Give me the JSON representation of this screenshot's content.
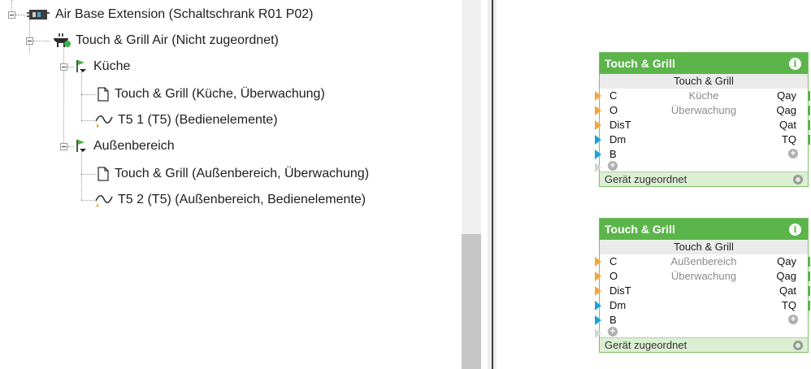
{
  "tree": {
    "nodes": [
      {
        "label": "Air Base Extension (Schaltschrank R01 P02)",
        "icon": "air-base-device-icon"
      },
      {
        "label": "Touch & Grill Air (Nicht zugeordnet)",
        "icon": "grill-device-icon"
      },
      {
        "label": "Küche",
        "icon": "room-flag-icon"
      },
      {
        "label": "Touch & Grill (Küche, Überwachung)",
        "icon": "document-icon"
      },
      {
        "label": "T5 1 (T5) (Bedienelemente)",
        "icon": "signal-wave-icon"
      },
      {
        "label": "Außenbereich",
        "icon": "room-flag-icon"
      },
      {
        "label": "Touch & Grill (Außenbereich, Überwachung)",
        "icon": "document-icon"
      },
      {
        "label": "T5 2 (T5) (Außenbereich, Bedienelemente)",
        "icon": "signal-wave-icon"
      }
    ]
  },
  "blocks": [
    {
      "title": "Touch & Grill",
      "subtitle": "Touch & Grill",
      "param1": "Küche",
      "param2": "Überwachung",
      "inputs": [
        "C",
        "O",
        "DisT",
        "Dm",
        "B"
      ],
      "outputs": [
        "Qay",
        "Qag",
        "Qat",
        "TQ"
      ],
      "footer": "Gerät zugeordnet"
    },
    {
      "title": "Touch & Grill",
      "subtitle": "Touch & Grill",
      "param1": "Außenbereich",
      "param2": "Überwachung",
      "inputs": [
        "C",
        "O",
        "DisT",
        "Dm",
        "B"
      ],
      "outputs": [
        "Qay",
        "Qag",
        "Qat",
        "TQ"
      ],
      "footer": "Gerät zugeordnet"
    }
  ],
  "colors": {
    "block_header": "#5cb54a",
    "port_orange": "#f5a53c",
    "port_blue": "#1aa3d8"
  }
}
